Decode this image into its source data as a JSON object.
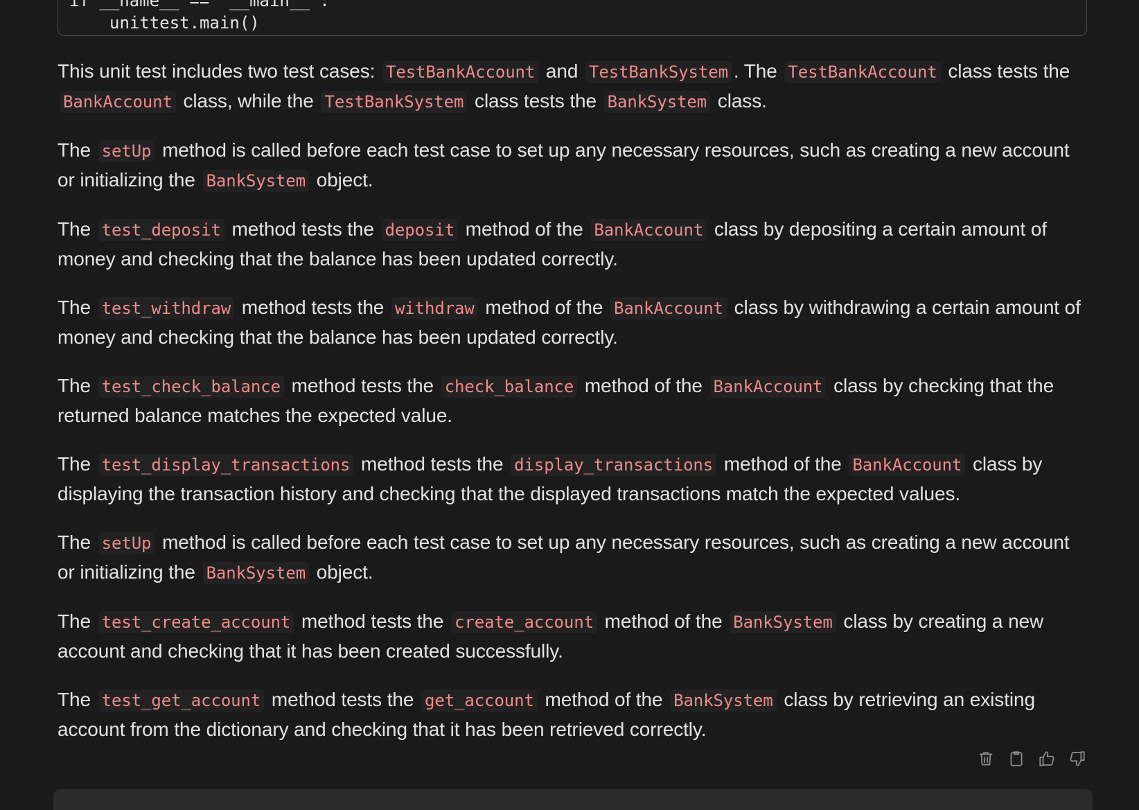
{
  "code_block": {
    "line1": "if __name__ == '__main__':",
    "line2": "unittest.main()"
  },
  "paragraphs": [
    [
      "This unit test includes two test cases: ",
      {
        "code": "TestBankAccount"
      },
      " and ",
      {
        "code": "TestBankSystem"
      },
      ". The ",
      {
        "code": "TestBankAccount"
      },
      " class tests the ",
      {
        "code": "BankAccount"
      },
      " class, while the ",
      {
        "code": "TestBankSystem"
      },
      " class tests the ",
      {
        "code": "BankSystem"
      },
      " class."
    ],
    [
      "The ",
      {
        "code": "setUp"
      },
      " method is called before each test case to set up any necessary resources, such as creating a new account or initializing the ",
      {
        "code": "BankSystem"
      },
      " object."
    ],
    [
      "The ",
      {
        "code": "test_deposit"
      },
      " method tests the ",
      {
        "code": "deposit"
      },
      " method of the ",
      {
        "code": "BankAccount"
      },
      " class by depositing a certain amount of money and checking that the balance has been updated correctly."
    ],
    [
      "The ",
      {
        "code": "test_withdraw"
      },
      " method tests the ",
      {
        "code": "withdraw"
      },
      " method of the ",
      {
        "code": "BankAccount"
      },
      " class by withdrawing a certain amount of money and checking that the balance has been updated correctly."
    ],
    [
      "The ",
      {
        "code": "test_check_balance"
      },
      " method tests the ",
      {
        "code": "check_balance"
      },
      " method of the ",
      {
        "code": "BankAccount"
      },
      " class by checking that the returned balance matches the expected value."
    ],
    [
      "The ",
      {
        "code": "test_display_transactions"
      },
      " method tests the ",
      {
        "code": "display_transactions"
      },
      " method of the ",
      {
        "code": "BankAccount"
      },
      " class by displaying the transaction history and checking that the displayed transactions match the expected values."
    ],
    [
      "The ",
      {
        "code": "setUp"
      },
      " method is called before each test case to set up any necessary resources, such as creating a new account or initializing the ",
      {
        "code": "BankSystem"
      },
      " object."
    ],
    [
      "The ",
      {
        "code": "test_create_account"
      },
      " method tests the ",
      {
        "code": "create_account"
      },
      " method of the ",
      {
        "code": "BankSystem"
      },
      " class by creating a new account and checking that it has been created successfully."
    ],
    [
      "The ",
      {
        "code": "test_get_account"
      },
      " method tests the ",
      {
        "code": "get_account"
      },
      " method of the ",
      {
        "code": "BankSystem"
      },
      " class by retrieving an existing account from the dictionary and checking that it has been retrieved correctly."
    ]
  ],
  "actions": [
    {
      "name": "delete-icon"
    },
    {
      "name": "copy-icon"
    },
    {
      "name": "thumbs-up-icon"
    },
    {
      "name": "thumbs-down-icon"
    }
  ],
  "colors": {
    "background": "#1a1a1a",
    "text": "#e3e3e3",
    "inline_code": "#ef8a8a",
    "icon": "#8e8e8e"
  }
}
